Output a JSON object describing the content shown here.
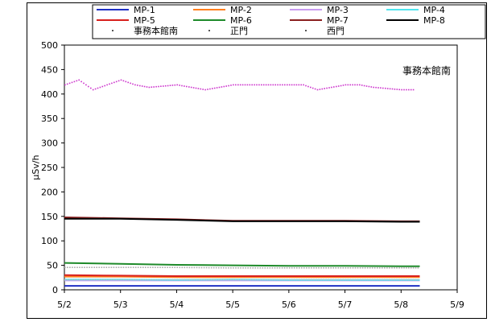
{
  "chart_data": {
    "type": "line",
    "title": "",
    "xlabel": "",
    "ylabel": "μSv/h",
    "ylim": [
      0,
      500
    ],
    "yticks": [
      0,
      50,
      100,
      150,
      200,
      250,
      300,
      350,
      400,
      450,
      500
    ],
    "xticks": [
      "5/2",
      "5/3",
      "5/4",
      "5/5",
      "5/6",
      "5/7",
      "5/8",
      "5/9"
    ],
    "xlim": [
      "5/2",
      "5/9"
    ],
    "annotation": "事務本館南",
    "grid": false,
    "legend_position": "top",
    "series": [
      {
        "name": "MP-1",
        "color": "#1f2fc4",
        "style": "line",
        "x": [
          "5/2",
          "5/3",
          "5/4",
          "5/5",
          "5/6",
          "5/7",
          "5/8",
          "5/8 08:00"
        ],
        "values": [
          8,
          8,
          8,
          8,
          8,
          8,
          8,
          8
        ]
      },
      {
        "name": "MP-2",
        "color": "#ff7f1e",
        "style": "line",
        "x": [
          "5/2",
          "5/3",
          "5/4",
          "5/5",
          "5/6",
          "5/7",
          "5/8",
          "5/8 08:00"
        ],
        "values": [
          27,
          27,
          26,
          26,
          26,
          26,
          26,
          26
        ]
      },
      {
        "name": "MP-3",
        "color": "#c99bf0",
        "style": "line",
        "x": [
          "5/2",
          "5/3",
          "5/4",
          "5/5",
          "5/6",
          "5/7",
          "5/8",
          "5/8 08:00"
        ],
        "values": [
          19,
          19,
          19,
          19,
          19,
          19,
          19,
          19
        ]
      },
      {
        "name": "MP-4",
        "color": "#4fe6ef",
        "style": "line",
        "x": [
          "5/2",
          "5/3",
          "5/4",
          "5/5",
          "5/6",
          "5/7",
          "5/8",
          "5/8 08:00"
        ],
        "values": [
          21,
          21,
          20,
          21,
          20,
          20,
          20,
          20
        ]
      },
      {
        "name": "MP-5",
        "color": "#d8201d",
        "style": "line",
        "x": [
          "5/2",
          "5/3",
          "5/4",
          "5/5",
          "5/6",
          "5/7",
          "5/8",
          "5/8 08:00"
        ],
        "values": [
          30,
          29,
          28,
          28,
          28,
          28,
          28,
          28
        ]
      },
      {
        "name": "MP-6",
        "color": "#1e8a2a",
        "style": "line",
        "x": [
          "5/2",
          "5/3",
          "5/4",
          "5/5",
          "5/6",
          "5/7",
          "5/8",
          "5/8 08:00"
        ],
        "values": [
          55,
          53,
          51,
          50,
          49,
          49,
          48,
          48
        ]
      },
      {
        "name": "MP-7",
        "color": "#8a1f1f",
        "style": "line",
        "x": [
          "5/2",
          "5/3",
          "5/4",
          "5/5",
          "5/6",
          "5/7",
          "5/8",
          "5/8 08:00"
        ],
        "values": [
          148,
          146,
          144,
          141,
          141,
          141,
          140,
          140
        ]
      },
      {
        "name": "MP-8",
        "color": "#000000",
        "style": "line",
        "x": [
          "5/2",
          "5/3",
          "5/4",
          "5/5",
          "5/6",
          "5/7",
          "5/8",
          "5/8 08:00"
        ],
        "values": [
          145,
          145,
          143,
          140,
          140,
          140,
          139,
          139
        ]
      },
      {
        "name": "事務本館南",
        "color": "#cc33cc",
        "style": "dots",
        "x": [
          "5/2",
          "5/2 06:00",
          "5/2 12:00",
          "5/3",
          "5/3 06:00",
          "5/3 12:00",
          "5/4",
          "5/4 06:00",
          "5/4 12:00",
          "5/5",
          "5/5 06:00",
          "5/5 12:00",
          "5/6",
          "5/6 06:00",
          "5/6 12:00",
          "5/7",
          "5/7 06:00",
          "5/7 12:00",
          "5/8",
          "5/8 06:00"
        ],
        "values": [
          420,
          430,
          410,
          430,
          420,
          415,
          420,
          415,
          410,
          420,
          420,
          420,
          420,
          420,
          410,
          420,
          420,
          415,
          410,
          410
        ]
      },
      {
        "name": "正門",
        "color": "#aaaaaa",
        "style": "dots",
        "x": [
          "5/2",
          "5/3",
          "5/4",
          "5/5",
          "5/6",
          "5/7",
          "5/8",
          "5/8 08:00"
        ],
        "values": [
          47,
          47,
          47,
          46,
          46,
          46,
          46,
          46
        ]
      },
      {
        "name": "西門",
        "color": "#bbbbbb",
        "style": "dots",
        "x": [
          "5/2",
          "5/3",
          "5/4",
          "5/5",
          "5/6",
          "5/7",
          "5/8",
          "5/8 08:00"
        ],
        "values": [
          22,
          22,
          22,
          22,
          22,
          22,
          22,
          22
        ]
      }
    ]
  }
}
